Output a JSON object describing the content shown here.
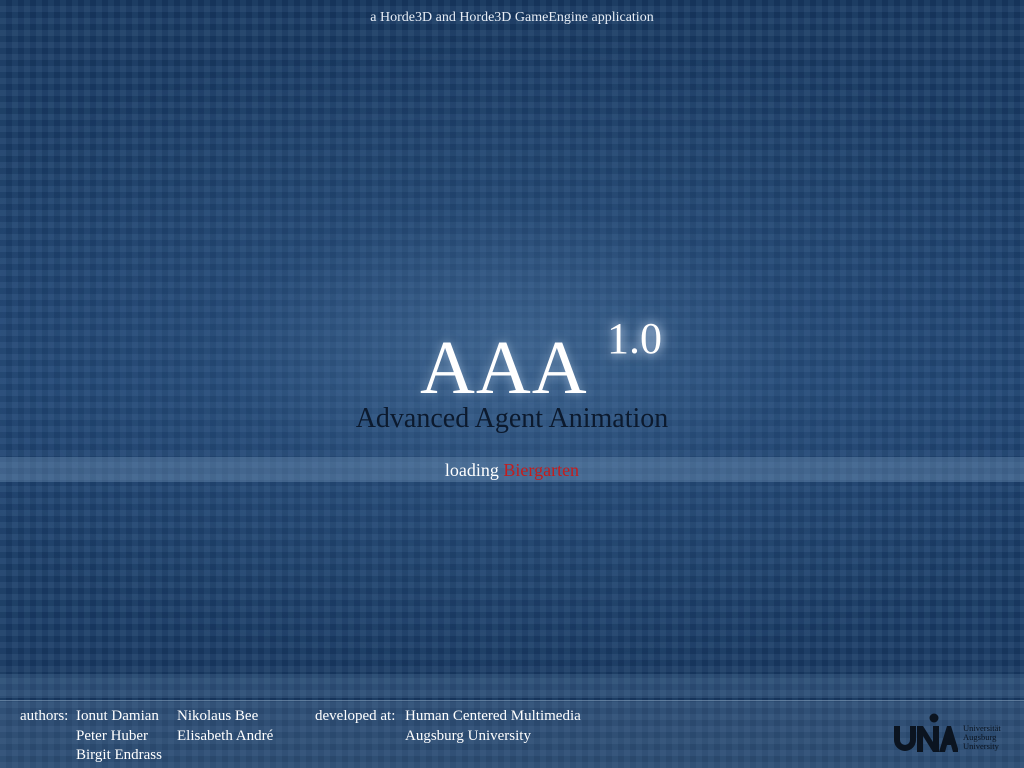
{
  "header": {
    "tagline": "a Horde3D and Horde3D GameEngine application"
  },
  "logo": {
    "title": "AAA",
    "version": "1.0",
    "subtitle": "Advanced Agent Animation"
  },
  "loading": {
    "prefix": "loading",
    "target": "Biergarten",
    "target_color": "#c41d1d"
  },
  "footer": {
    "authors_label": "authors:",
    "authors_col1": [
      "Ionut Damian",
      "Peter Huber",
      "Birgit Endrass"
    ],
    "authors_col2": [
      "Nikolaus Bee",
      "Elisabeth André"
    ],
    "developed_label": "developed at:",
    "developed_lines": [
      "Human Centered Multimedia",
      "Augsburg University"
    ]
  },
  "university_logo": {
    "mark": "UNA",
    "lines": [
      "Universität",
      "Augsburg",
      "University"
    ],
    "icon": "university-logo-icon"
  },
  "colors": {
    "background": "#1b3d66",
    "subtitle_text": "#0c1a2e"
  }
}
